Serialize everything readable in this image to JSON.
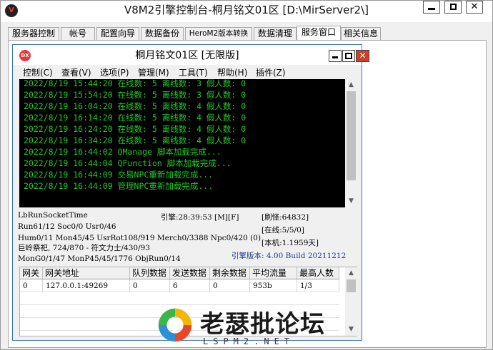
{
  "window": {
    "title": "V8M2引擎控制台-桐月铭文01区 [D:\\MirServer2\\]",
    "icon": "app-logo-icon",
    "close_glyph": "✕"
  },
  "tabs": [
    {
      "label": "服务器控制",
      "active": false
    },
    {
      "label": "帐号",
      "active": false
    },
    {
      "label": "配置向导",
      "active": false
    },
    {
      "label": "数据备份",
      "active": false
    },
    {
      "label": "HeroM2版本转换",
      "active": false
    },
    {
      "label": "数据清理",
      "active": false
    },
    {
      "label": "服务窗口",
      "active": true
    },
    {
      "label": "相关信息",
      "active": false
    }
  ],
  "server_window": {
    "title": "桐月铭文01区 [无限版]",
    "icon_text": "DX",
    "close_glyph": "✕",
    "menu": [
      "控制(C)",
      "查看(V)",
      "选项(P)",
      "管理(M)",
      "工具(T)",
      "帮助(H)",
      "插件(Z)"
    ],
    "console_lines": [
      "2022/8/19 15:44:20 在线数: 5 离线数: 3 假人数: 0",
      "2022/8/19 15:54:20 在线数: 5 离线数: 3 假人数: 0",
      "2022/8/19 16:04:20 在线数: 5 离线数: 4 假人数: 0",
      "2022/8/19 16:14:20 在线数: 5 离线数: 4 假人数: 0",
      "2022/8/19 16:24:20 在线数: 5 离线数: 4 假人数: 0",
      "2022/8/19 16:34:20 在线数: 5 离线数: 4 假人数: 0",
      "2022/8/19 16:44:02 QManage 脚本加载完成...",
      "2022/8/19 16:44:04 QFunction 脚本加载完成...",
      "2022/8/19 16:44:09 交易NPC重新加载完成...",
      "2022/8/19 16:44:09 管理NPC重新加载完成..."
    ],
    "status": {
      "socket": "LbRunSocketTime",
      "run_line": "Run61/12 Soc0/0 Usr0/46",
      "hum_line": "Hum0/11 Mon45/45 UsrRot108/919 Merch0/3388 Npc0/420 (0)",
      "ritual_line": "巨岭祭祀, 724/870 - 符文力士/430/93",
      "mongen_line": "MonG0/1/47 MonP45/45/1776 ObjRun0/14",
      "engine_time": "引擎:28:39:53 [M][F]",
      "refresh": "[刷怪:64832]",
      "online": "[在线:5/5/0]",
      "local": "[本机:1.1959天]",
      "engine_version": "引擎版本: 4.00 Build 20211212"
    },
    "gateway_table": {
      "headers": [
        "网关",
        "网关地址",
        "队列数据",
        "发送数据",
        "剩余数据",
        "平均流量",
        "最高人数"
      ],
      "rows": [
        [
          "0",
          "127.0.0.1:49269",
          "0",
          "6",
          "0",
          "953b",
          "1/3"
        ]
      ]
    }
  },
  "watermark": {
    "name": "老瑟批论坛",
    "url": "LSPM2.NET"
  }
}
